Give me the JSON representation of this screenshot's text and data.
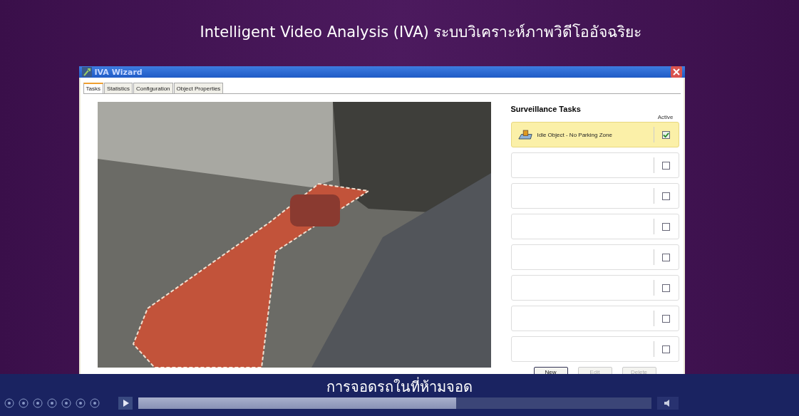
{
  "slide_title": "Intelligent Video Analysis (IVA) ระบบวิเคราะห์ภาพวิดีโออัจฉริยะ",
  "window": {
    "title": "IVA Wizard"
  },
  "tabs": [
    {
      "label": "Tasks",
      "selected": true
    },
    {
      "label": "Statistics",
      "selected": false
    },
    {
      "label": "Configuration",
      "selected": false
    },
    {
      "label": "Object Properties",
      "selected": false
    }
  ],
  "tasks_panel": {
    "title": "Surveillance Tasks",
    "active_header": "Active",
    "tasks": [
      {
        "name": "Idle Object - No Parking Zone",
        "active": true,
        "selected": true
      },
      {
        "active": false,
        "selected": false
      },
      {
        "active": false,
        "selected": false
      },
      {
        "active": false,
        "selected": false
      },
      {
        "active": false,
        "selected": false
      },
      {
        "active": false,
        "selected": false
      },
      {
        "active": false,
        "selected": false
      },
      {
        "active": false,
        "selected": false
      }
    ],
    "buttons": [
      {
        "label": "New",
        "disabled": false
      },
      {
        "label": "Edit",
        "disabled": true
      },
      {
        "label": "Delete",
        "disabled": true
      }
    ]
  },
  "caption": "การจอดรถในที่ห้ามจอด",
  "player": {
    "level": 0.62
  }
}
